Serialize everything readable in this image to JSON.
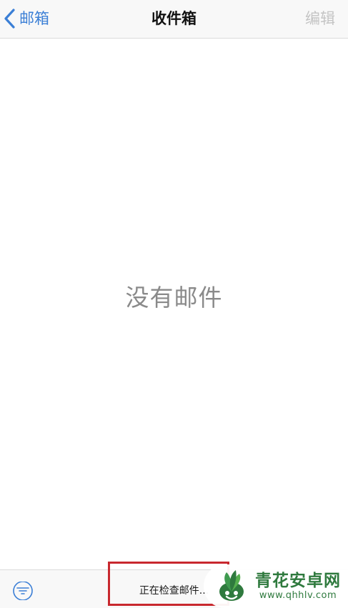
{
  "navbar": {
    "back_label": "邮箱",
    "title": "收件箱",
    "edit_label": "编辑"
  },
  "main": {
    "empty_message": "没有邮件"
  },
  "toolbar": {
    "filter_icon": "filter-icon",
    "status": "正在检查邮件..."
  },
  "watermark": {
    "name": "青花安卓网",
    "url": "www.qhhlv.com"
  },
  "colors": {
    "accent": "#3b7fd6",
    "disabled": "#c4c4c4",
    "highlight": "#c8282e",
    "watermark": "#2f7a3e"
  }
}
